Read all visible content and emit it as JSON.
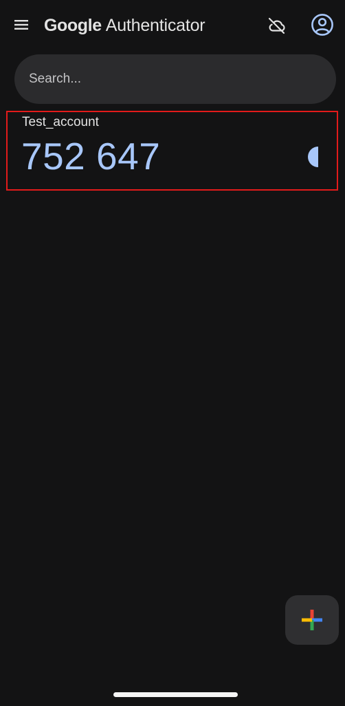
{
  "header": {
    "title_brand": "Google",
    "title_product": "Authenticator",
    "menu_icon": "hamburger-menu-icon",
    "sync_icon": "cloud-off-icon",
    "account_icon": "account-circle-icon"
  },
  "search": {
    "placeholder": "Search...",
    "value": ""
  },
  "accounts": [
    {
      "name": "Test_account",
      "code": "752 647",
      "timer_remaining": 0.5,
      "timer_icon": "countdown-pie-icon"
    }
  ],
  "fab": {
    "icon": "google-plus-icon",
    "colors": [
      "#ea4335",
      "#4285f4",
      "#34a853",
      "#fbbc04"
    ]
  },
  "colors": {
    "background": "#131314",
    "surface": "#2b2b2d",
    "code": "#a8c7fa",
    "highlight_border": "#e31b1b"
  }
}
